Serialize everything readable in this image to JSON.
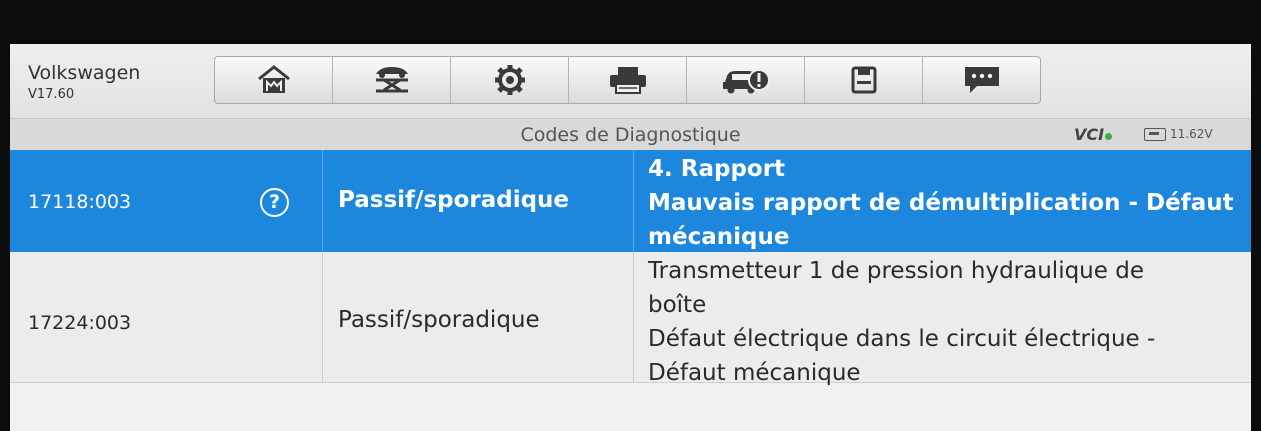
{
  "header": {
    "brand": "Volkswagen",
    "version": "V17.60",
    "toolbar": [
      {
        "icon": "home-icon"
      },
      {
        "icon": "vehicle-lift-icon"
      },
      {
        "icon": "gear-icon"
      },
      {
        "icon": "printer-icon"
      },
      {
        "icon": "car-info-icon"
      },
      {
        "icon": "save-icon"
      },
      {
        "icon": "message-icon"
      }
    ]
  },
  "titlebar": {
    "title": "Codes de Diagnostique",
    "vci": "VCI",
    "vci_status_color": "#3db043",
    "voltage": "11.62V"
  },
  "dtc_rows": [
    {
      "code": "17118:003",
      "status": "Passif/sporadique",
      "description_lines": [
        "4. Rapport",
        "Mauvais rapport de démultiplication - Défaut",
        "mécanique"
      ],
      "selected": true,
      "help_icon": "?"
    },
    {
      "code": "17224:003",
      "status": "Passif/sporadique",
      "description_lines": [
        "Transmetteur 1 de pression hydraulique de",
        "boîte",
        "Défaut électrique dans le circuit électrique -",
        "Défaut mécanique"
      ],
      "selected": false
    }
  ],
  "colors": {
    "selected_row": "#1c87dc",
    "row_bg": "#ececec",
    "header_bg": "#e8e8e8"
  }
}
